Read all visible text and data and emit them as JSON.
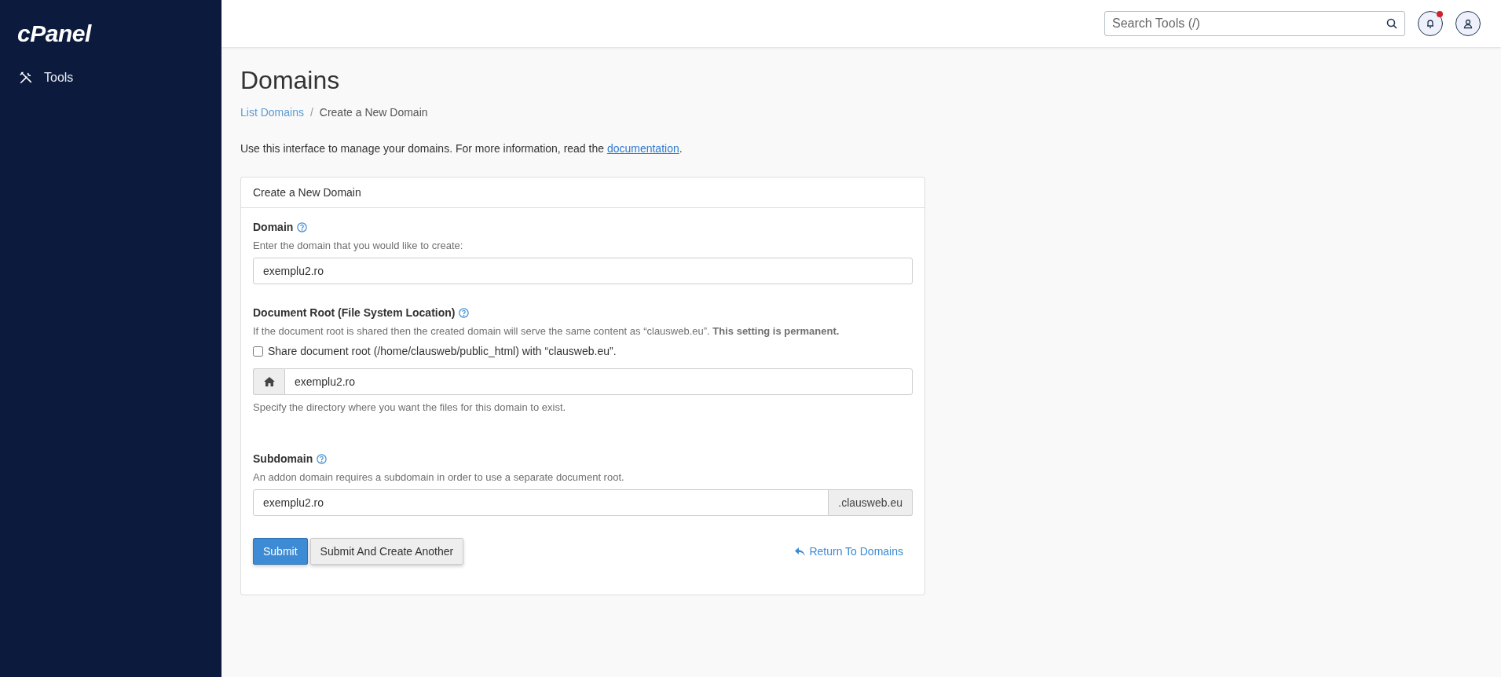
{
  "sidebar": {
    "logo": "cPanel",
    "items": [
      {
        "label": "Tools"
      }
    ]
  },
  "header": {
    "search": {
      "placeholder": "Search Tools (/)"
    },
    "notifications": {
      "unread": true
    }
  },
  "page": {
    "title": "Domains",
    "breadcrumb_separator": "/",
    "breadcrumb": [
      {
        "label": "List Domains",
        "kind": "link"
      },
      {
        "label": "Create a New Domain",
        "kind": "current"
      }
    ],
    "intro": {
      "text": "Use this interface to manage your domains. For more information, read the ",
      "link": "documentation",
      "end": "."
    }
  },
  "panel": {
    "title": "Create a New Domain",
    "domain": {
      "label": "Domain",
      "help": "Enter the domain that you would like to create:",
      "value": "exemplu2.ro"
    },
    "document_root": {
      "label": "Document Root (File System Location)",
      "help": "If the document root is shared then the created domain will serve the same content as “clausweb.eu”. **This setting is permanent.**",
      "share": {
        "label": "Share document root (/home/clausweb/public_html) with “clausweb.eu”.",
        "checked": false
      },
      "value": "exemplu2.ro",
      "note": "Specify the directory where you want the files for this domain to exist."
    },
    "subdomain": {
      "label": "Subdomain",
      "help": "An addon domain requires a subdomain in order to use a separate document root.",
      "value": "exemplu2.ro",
      "suffix": ".clausweb.eu"
    },
    "buttons": [
      {
        "label": "Submit",
        "kind": "primary"
      },
      {
        "label": "Submit And Create Another",
        "kind": "default"
      }
    ],
    "return_link": "Return To Domains"
  }
}
